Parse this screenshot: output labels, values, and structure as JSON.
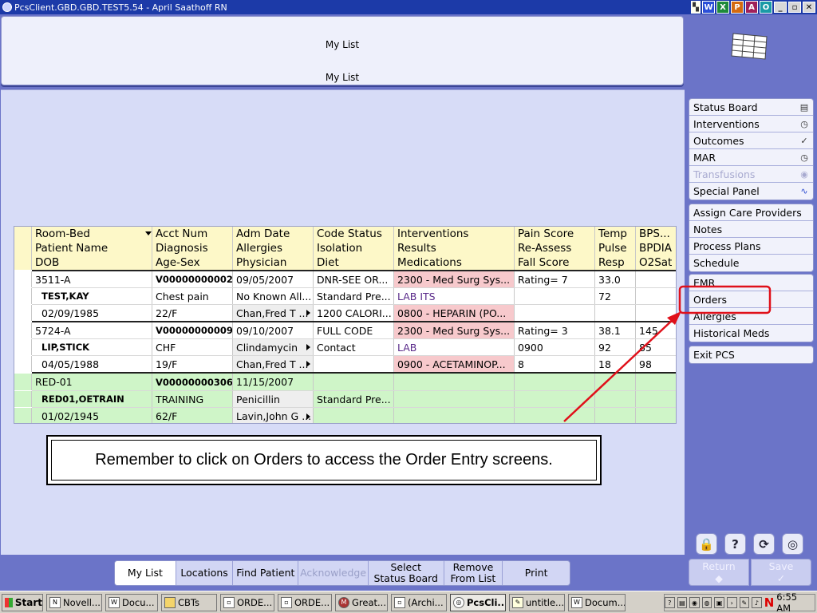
{
  "window": {
    "title": "PcsClient.GBD.GBD.TEST5.54 - April Saathoff RN",
    "right_icons": [
      "W",
      "X",
      "P",
      "A",
      "O"
    ],
    "controls": [
      "_",
      "▫",
      "✕"
    ]
  },
  "header": {
    "title_top": "My List",
    "title_bottom": "My List"
  },
  "table": {
    "header_rows": [
      [
        "Room-Bed",
        "Acct Num",
        "Adm Date",
        "Code Status",
        "Interventions",
        "Pain Score",
        "Temp",
        "BPS..."
      ],
      [
        "Patient Name",
        "Diagnosis",
        "Allergies",
        "Isolation",
        "Results",
        "Re-Assess",
        "Pulse",
        "BPDIA"
      ],
      [
        "DOB",
        "Age-Sex",
        "Physician",
        "Diet",
        "Medications",
        "Fall Score",
        "Resp",
        "O2Sat"
      ]
    ],
    "patients": [
      {
        "rows": [
          [
            "3511-A",
            "V00000000002",
            "09/05/2007",
            "DNR-SEE OR...",
            "2300 - Med Surg Sys...",
            "Rating= 7",
            "33.0",
            ""
          ],
          [
            "TEST,KAY",
            "Chest pain",
            "No Known All...",
            "Standard Pre...",
            "LAB ITS",
            "",
            "72",
            ""
          ],
          [
            "02/09/1985",
            "22/F",
            "Chan,Fred T ...",
            "1200 CALORI...",
            "0800 - HEPARIN (PO...",
            "",
            "",
            ""
          ]
        ]
      },
      {
        "rows": [
          [
            "5724-A",
            "V00000000009",
            "09/10/2007",
            "FULL CODE",
            "2300 - Med Surg Sys...",
            "Rating= 3",
            "38.1",
            "145"
          ],
          [
            "LIP,STICK",
            "CHF",
            "Clindamycin",
            "Contact",
            "LAB",
            "0900",
            "92",
            "85"
          ],
          [
            "04/05/1988",
            "19/F",
            "Chan,Fred T ...",
            "",
            "0900 - ACETAMINOP...",
            "8",
            "18",
            "98"
          ]
        ]
      },
      {
        "rows": [
          [
            "RED-01",
            "V00000000306",
            "11/15/2007",
            "",
            "",
            "",
            "",
            ""
          ],
          [
            "RED01,OETRAIN",
            "TRAINING",
            "Penicillin",
            "Standard Pre...",
            "",
            "",
            "",
            ""
          ],
          [
            "01/02/1945",
            "62/F",
            "Lavin,John G ...",
            "",
            "",
            "",
            "",
            ""
          ]
        ]
      }
    ]
  },
  "callout": {
    "text": "Remember to click on Orders to access the Order Entry screens."
  },
  "sidebar": {
    "group1": [
      {
        "label": "Status Board",
        "icon": "▤"
      },
      {
        "label": "Interventions",
        "icon": "◷"
      },
      {
        "label": "Outcomes",
        "icon": "✓"
      },
      {
        "label": "MAR",
        "icon": "◷"
      },
      {
        "label": "Transfusions",
        "icon": "◉"
      },
      {
        "label": "Special Panel",
        "icon": "∿"
      }
    ],
    "group2": [
      "Assign Care Providers",
      "Notes",
      "Process Plans",
      "Schedule"
    ],
    "group3": [
      "EMR",
      "Orders",
      "Allergies",
      "Historical Meds"
    ],
    "exit_label": "Exit PCS",
    "tool_icons": [
      "🔒",
      "?",
      "⟳",
      "◎"
    ],
    "return": {
      "label": "Return",
      "glyph": "◆"
    },
    "save": {
      "label": "Save",
      "glyph": "✓"
    }
  },
  "bottom_tabs": [
    {
      "line1": "My List",
      "line2": ""
    },
    {
      "line1": "Locations",
      "line2": ""
    },
    {
      "line1": "Find Patient",
      "line2": ""
    },
    {
      "line1": "Acknowledge",
      "line2": ""
    },
    {
      "line1": "Select",
      "line2": "Status Board"
    },
    {
      "line1": "Remove",
      "line2": "From List"
    },
    {
      "line1": "Print",
      "line2": ""
    }
  ],
  "taskbar": {
    "start_label": "Start",
    "tasks": [
      "Novell...",
      "Docu...",
      "CBTs",
      "ORDE...",
      "ORDE...",
      "Great...",
      "(Archi...",
      "PcsCli...",
      "untitle...",
      "Docum..."
    ],
    "clock": "6:55 AM",
    "tray_n": "N"
  }
}
